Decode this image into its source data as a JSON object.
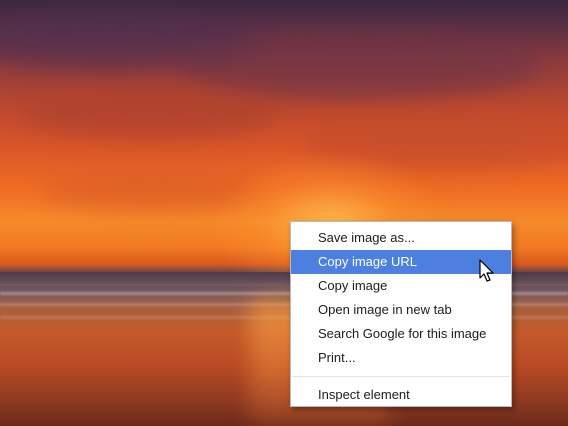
{
  "context_menu": {
    "items": [
      {
        "label": "Save image as...",
        "highlighted": false
      },
      {
        "label": "Copy image URL",
        "highlighted": true
      },
      {
        "label": "Copy image",
        "highlighted": false
      },
      {
        "label": "Open image in new tab",
        "highlighted": false
      },
      {
        "label": "Search Google for this image",
        "highlighted": false
      },
      {
        "label": "Print...",
        "highlighted": false
      }
    ],
    "footer_item": {
      "label": "Inspect element"
    }
  },
  "colors": {
    "highlight": "#4c7fe0",
    "menu_background": "#ffffff",
    "menu_text": "#1c1c1c"
  },
  "icons": {
    "cursor": "arrow-cursor-icon"
  }
}
